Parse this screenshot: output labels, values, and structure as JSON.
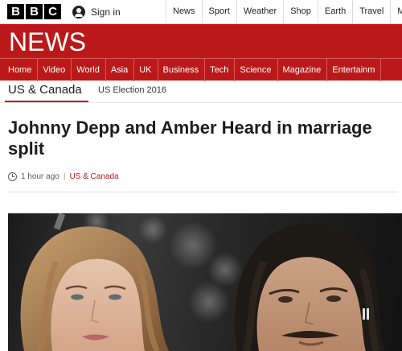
{
  "brand": {
    "letters": [
      "B",
      "B",
      "C"
    ]
  },
  "topbar": {
    "signin_label": "Sign in",
    "nav": [
      "News",
      "Sport",
      "Weather",
      "Shop",
      "Earth",
      "Travel",
      "M"
    ]
  },
  "news_header": {
    "logo_text": "NEWS",
    "nav": [
      "Home",
      "Video",
      "World",
      "Asia",
      "UK",
      "Business",
      "Tech",
      "Science",
      "Magazine",
      "Entertainm"
    ]
  },
  "subnav": {
    "primary": "US & Canada",
    "secondary": "US Election 2016"
  },
  "article": {
    "headline": "Johnny Depp and Amber Heard in marriage split",
    "time": "1 hour ago",
    "category": "US & Canada"
  },
  "colors": {
    "brand_red": "#bb1919",
    "text_dark": "#1d1d1d"
  },
  "icons": {
    "signin": "user-icon",
    "time": "clock-icon"
  }
}
